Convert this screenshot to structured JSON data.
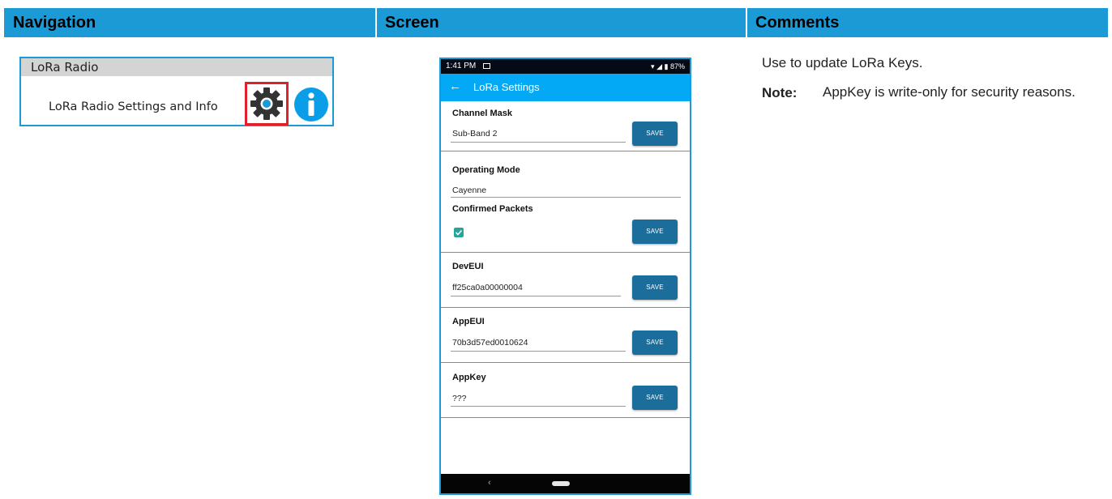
{
  "header": {
    "col1": "Navigation",
    "col2": "Screen",
    "col3": "Comments"
  },
  "navigation": {
    "section_title": "LoRa Radio",
    "item_label": "LoRa Radio Settings and Info",
    "icons": [
      "gear-icon",
      "info-icon"
    ]
  },
  "phone": {
    "status_bar": {
      "time": "1:41 PM",
      "battery": "87%"
    },
    "app_bar": {
      "title": "LoRa Settings"
    },
    "sections": {
      "channel_mask": {
        "label": "Channel Mask",
        "value": "Sub-Band 2",
        "button": "SAVE"
      },
      "operating_mode": {
        "label": "Operating Mode",
        "value": "Cayenne",
        "confirmed_label": "Confirmed Packets",
        "confirmed_checked": true,
        "button": "SAVE"
      },
      "dev_eui": {
        "label": "DevEUI",
        "value": "ff25ca0a00000004",
        "button": "SAVE"
      },
      "app_eui": {
        "label": "AppEUI",
        "value": "70b3d57ed0010624",
        "button": "SAVE"
      },
      "app_key": {
        "label": "AppKey",
        "value": "???",
        "button": "SAVE"
      }
    },
    "nav_bar": {
      "back_glyph": "‹"
    }
  },
  "comments": {
    "main": "Use to update LoRa Keys.",
    "note_label": "Note:",
    "note_text": "AppKey is write-only for security reasons."
  },
  "colors": {
    "header_blue": "#1b9ad6",
    "app_bar_blue": "#03a9f4",
    "save_button": "#1b6d9c",
    "checkbox": "#26a69a",
    "highlight_red": "#e0202a"
  }
}
